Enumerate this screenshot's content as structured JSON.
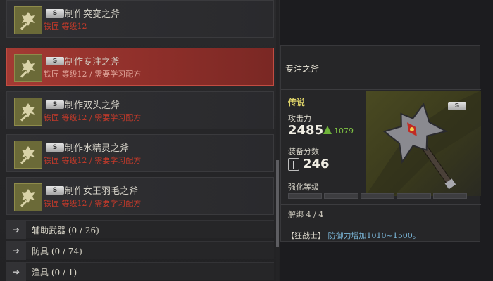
{
  "recipes": [
    {
      "grade": "S",
      "title": "制作突变之斧",
      "requirement": "铁匠 等级12"
    },
    {
      "grade": "S",
      "title": "制作专注之斧",
      "requirement": "铁匠 等级12 / 需要学习配方"
    },
    {
      "grade": "S",
      "title": "制作双头之斧",
      "requirement": "铁匠 等级12 / 需要学习配方"
    },
    {
      "grade": "S",
      "title": "制作水精灵之斧",
      "requirement": "铁匠 等级12 / 需要学习配方"
    },
    {
      "grade": "S",
      "title": "制作女王羽毛之斧",
      "requirement": "铁匠 等级12 / 需要学习配方"
    }
  ],
  "categories": [
    {
      "label": "辅助武器 (0 / 26)"
    },
    {
      "label": "防具 (0 / 74)"
    },
    {
      "label": "渔具 (0 / 1)"
    }
  ],
  "detail": {
    "name": "专注之斧",
    "rarity": "传说",
    "grade": "S",
    "attack_label": "攻击力",
    "attack_value": "2485",
    "attack_diff": "1079",
    "gear_score_label": "装备分数",
    "gear_score_value": "246",
    "enhance_label": "强化等级",
    "enhance_segments": 5,
    "binding": "解绑 4 / 4",
    "effect_tag": "【狂战士】",
    "effect_text": "防御力增加1010~1500。",
    "rarity_color": "#e0d56a",
    "diff_color": "#7ec143"
  },
  "icons": {
    "recipe_thumb": "axe-icon",
    "category_arrow": "arrow-right-icon",
    "diff": "up-arrow-icon",
    "gear_score": "gear-score-icon"
  }
}
